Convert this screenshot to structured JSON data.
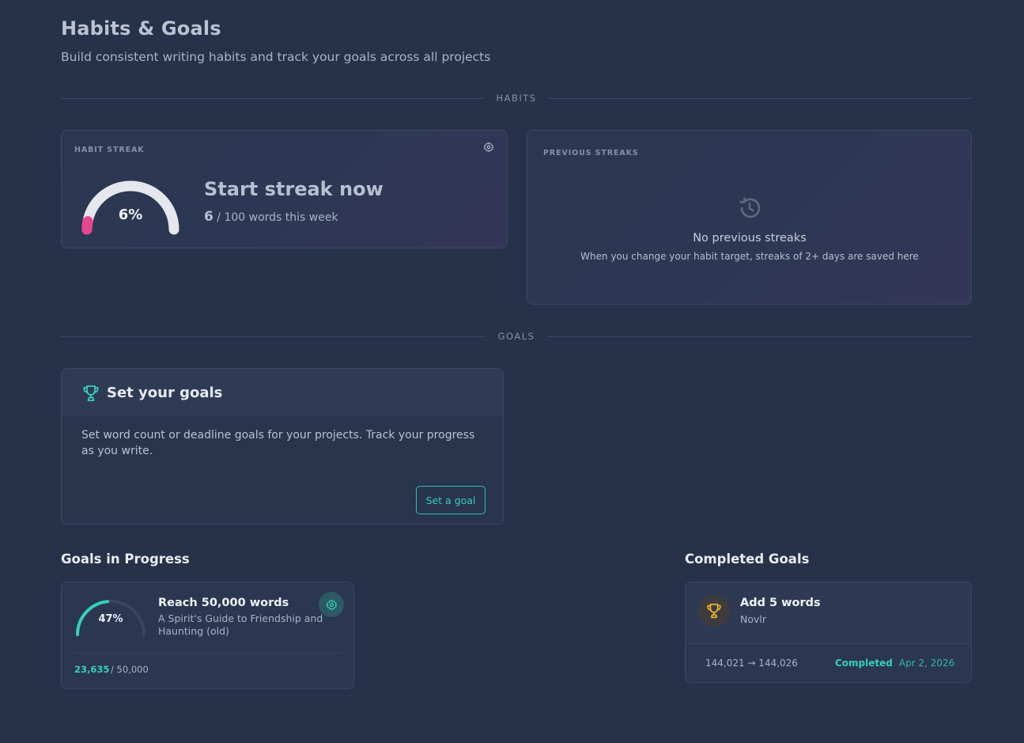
{
  "header": {
    "title": "Habits & Goals",
    "subtitle": "Build consistent writing habits and track your goals across all projects"
  },
  "sections": {
    "habits_label": "HABITS",
    "goals_label": "GOALS"
  },
  "habit_streak": {
    "label": "HABIT STREAK",
    "percent_text": "6%",
    "progress_fraction": 0.06,
    "headline": "Start streak now",
    "current_words": "6",
    "target_text": "/ 100 words this week",
    "icon": "gear-icon"
  },
  "previous_streaks": {
    "label": "PREVIOUS STREAKS",
    "icon": "history-icon",
    "empty_title": "No previous streaks",
    "empty_text": "When you change your habit target, streaks of 2+ days are saved here"
  },
  "set_goals": {
    "icon": "trophy-icon",
    "title": "Set your goals",
    "text": "Set word count or deadline goals for your projects. Track your progress as you write.",
    "button_label": "Set a goal"
  },
  "in_progress": {
    "heading": "Goals in Progress",
    "goals": [
      {
        "title": "Reach 50,000 words",
        "project": "A Spirit's Guide to Friendship and Haunting (old)",
        "percent_text": "47%",
        "progress_fraction": 0.47,
        "current": "23,635",
        "target": "/ 50,000"
      }
    ]
  },
  "completed": {
    "heading": "Completed Goals",
    "goals": [
      {
        "title": "Add 5 words",
        "project": "Novlr",
        "range": "144,021 → 144,026",
        "status": "Completed",
        "date": "Apr 2, 2026"
      }
    ]
  },
  "colors": {
    "background": "#273149",
    "accent_teal": "#35d0bd",
    "streak_pink": "#e8458f",
    "trophy_gold": "#f0b429"
  }
}
